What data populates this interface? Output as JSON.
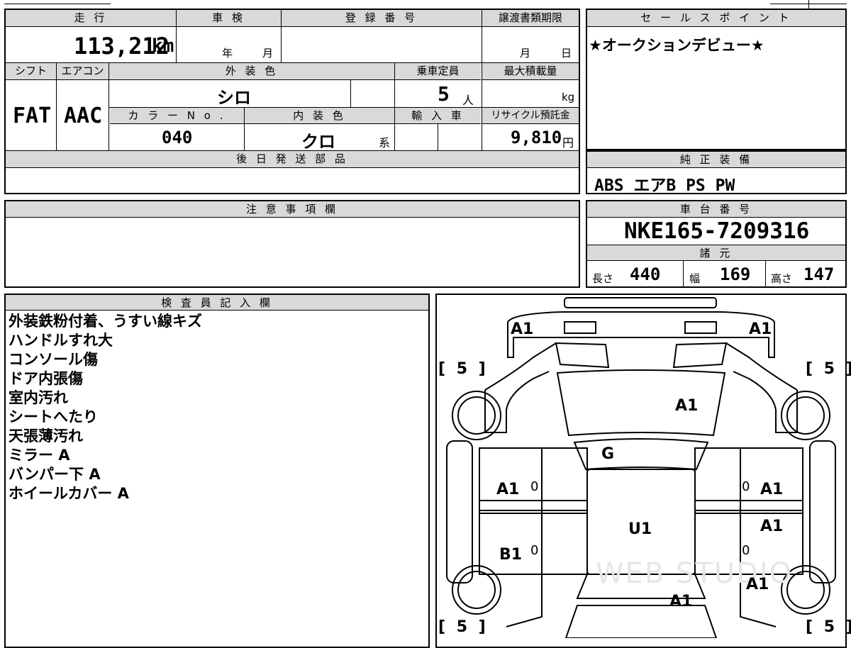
{
  "top": {
    "mileage_label": "走 行",
    "mileage_value": "113,212",
    "mileage_unit": "km",
    "inspection_label": "車 検",
    "inspection_year": "年",
    "inspection_month": "月",
    "registration_label": "登 録 番 号",
    "transfer_deadline_label": "譲渡書類期限",
    "transfer_month": "月",
    "transfer_day": "日",
    "shift_label": "シフト",
    "shift_value": "FAT",
    "ac_label": "エアコン",
    "ac_value": "AAC",
    "exterior_color_label": "外 装 色",
    "exterior_color_value": "シロ",
    "capacity_label": "乗車定員",
    "capacity_value": "5",
    "capacity_unit": "人",
    "max_load_label": "最大積載量",
    "max_load_unit": "kg",
    "color_no_label": "カ ラ ー N o .",
    "color_no_value": "040",
    "interior_color_label": "内 装 色",
    "interior_color_value": "クロ",
    "interior_color_suffix": "系",
    "import_label": "輸 入 車",
    "recycle_label": "リサイクル預託金",
    "recycle_value": "9,810",
    "recycle_unit": "円",
    "later_parts_label": "後 日 発 送 部 品"
  },
  "sales_point": {
    "label": "セ ー ル ス ポ イ ン ト",
    "text": "★オークションデビュー★"
  },
  "equipment": {
    "label": "純 正 装 備",
    "text": "ABS エアB PS PW"
  },
  "notes_section": {
    "label": "注 意 事 項 欄"
  },
  "chassis": {
    "label": "車 台 番 号",
    "value": "NKE165-7209316"
  },
  "specs": {
    "label": "諸 元",
    "length_label": "長さ",
    "length_value": "440",
    "width_label": "幅",
    "width_value": "169",
    "height_label": "高さ",
    "height_value": "147"
  },
  "inspector": {
    "label": "検 査 員 記 入 欄",
    "lines": [
      "外装鉄粉付着、うすい線キズ",
      "ハンドルすれ大",
      "コンソール傷",
      "ドア内張傷",
      "室内汚れ",
      "シートへたり",
      "天張薄汚れ",
      "ミラー A",
      "バンパー下 A",
      "ホイールカバー A"
    ]
  },
  "diagram": {
    "marks": {
      "front_left": "A1",
      "front_right": "A1",
      "hood": "A1",
      "windshield": "G",
      "roof": "U1",
      "left_front_door": "A1",
      "left_rear_door": "B1",
      "right_front_door": "A1",
      "right_rear_door": "A1",
      "right_rear_fender": "A1",
      "rear": "A1",
      "door_zero_1": "0",
      "door_zero_2": "0",
      "door_zero_3": "0",
      "door_zero_4": "0"
    },
    "tire_tl": "[ 5 ]",
    "tire_tr": "[ 5 ]",
    "tire_bl": "[ 5 ]",
    "tire_br": "[ 5 ]",
    "watermark": "WEB STUDIO"
  }
}
